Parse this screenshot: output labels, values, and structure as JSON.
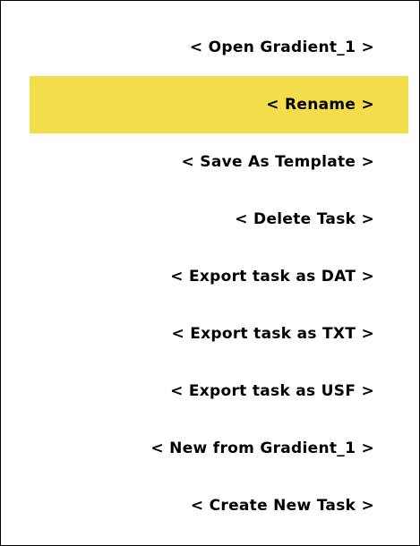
{
  "menu": {
    "items": [
      {
        "label": "< Open Gradient_1 >",
        "selected": false
      },
      {
        "label": "< Rename >",
        "selected": true
      },
      {
        "label": "< Save As Template >",
        "selected": false
      },
      {
        "label": "< Delete Task >",
        "selected": false
      },
      {
        "label": "< Export task as DAT >",
        "selected": false
      },
      {
        "label": "< Export task as TXT >",
        "selected": false
      },
      {
        "label": "< Export task as USF >",
        "selected": false
      },
      {
        "label": "< New from Gradient_1 >",
        "selected": false
      },
      {
        "label": "< Create New Task >",
        "selected": false
      }
    ],
    "highlight_color": "#f4dd4a"
  }
}
